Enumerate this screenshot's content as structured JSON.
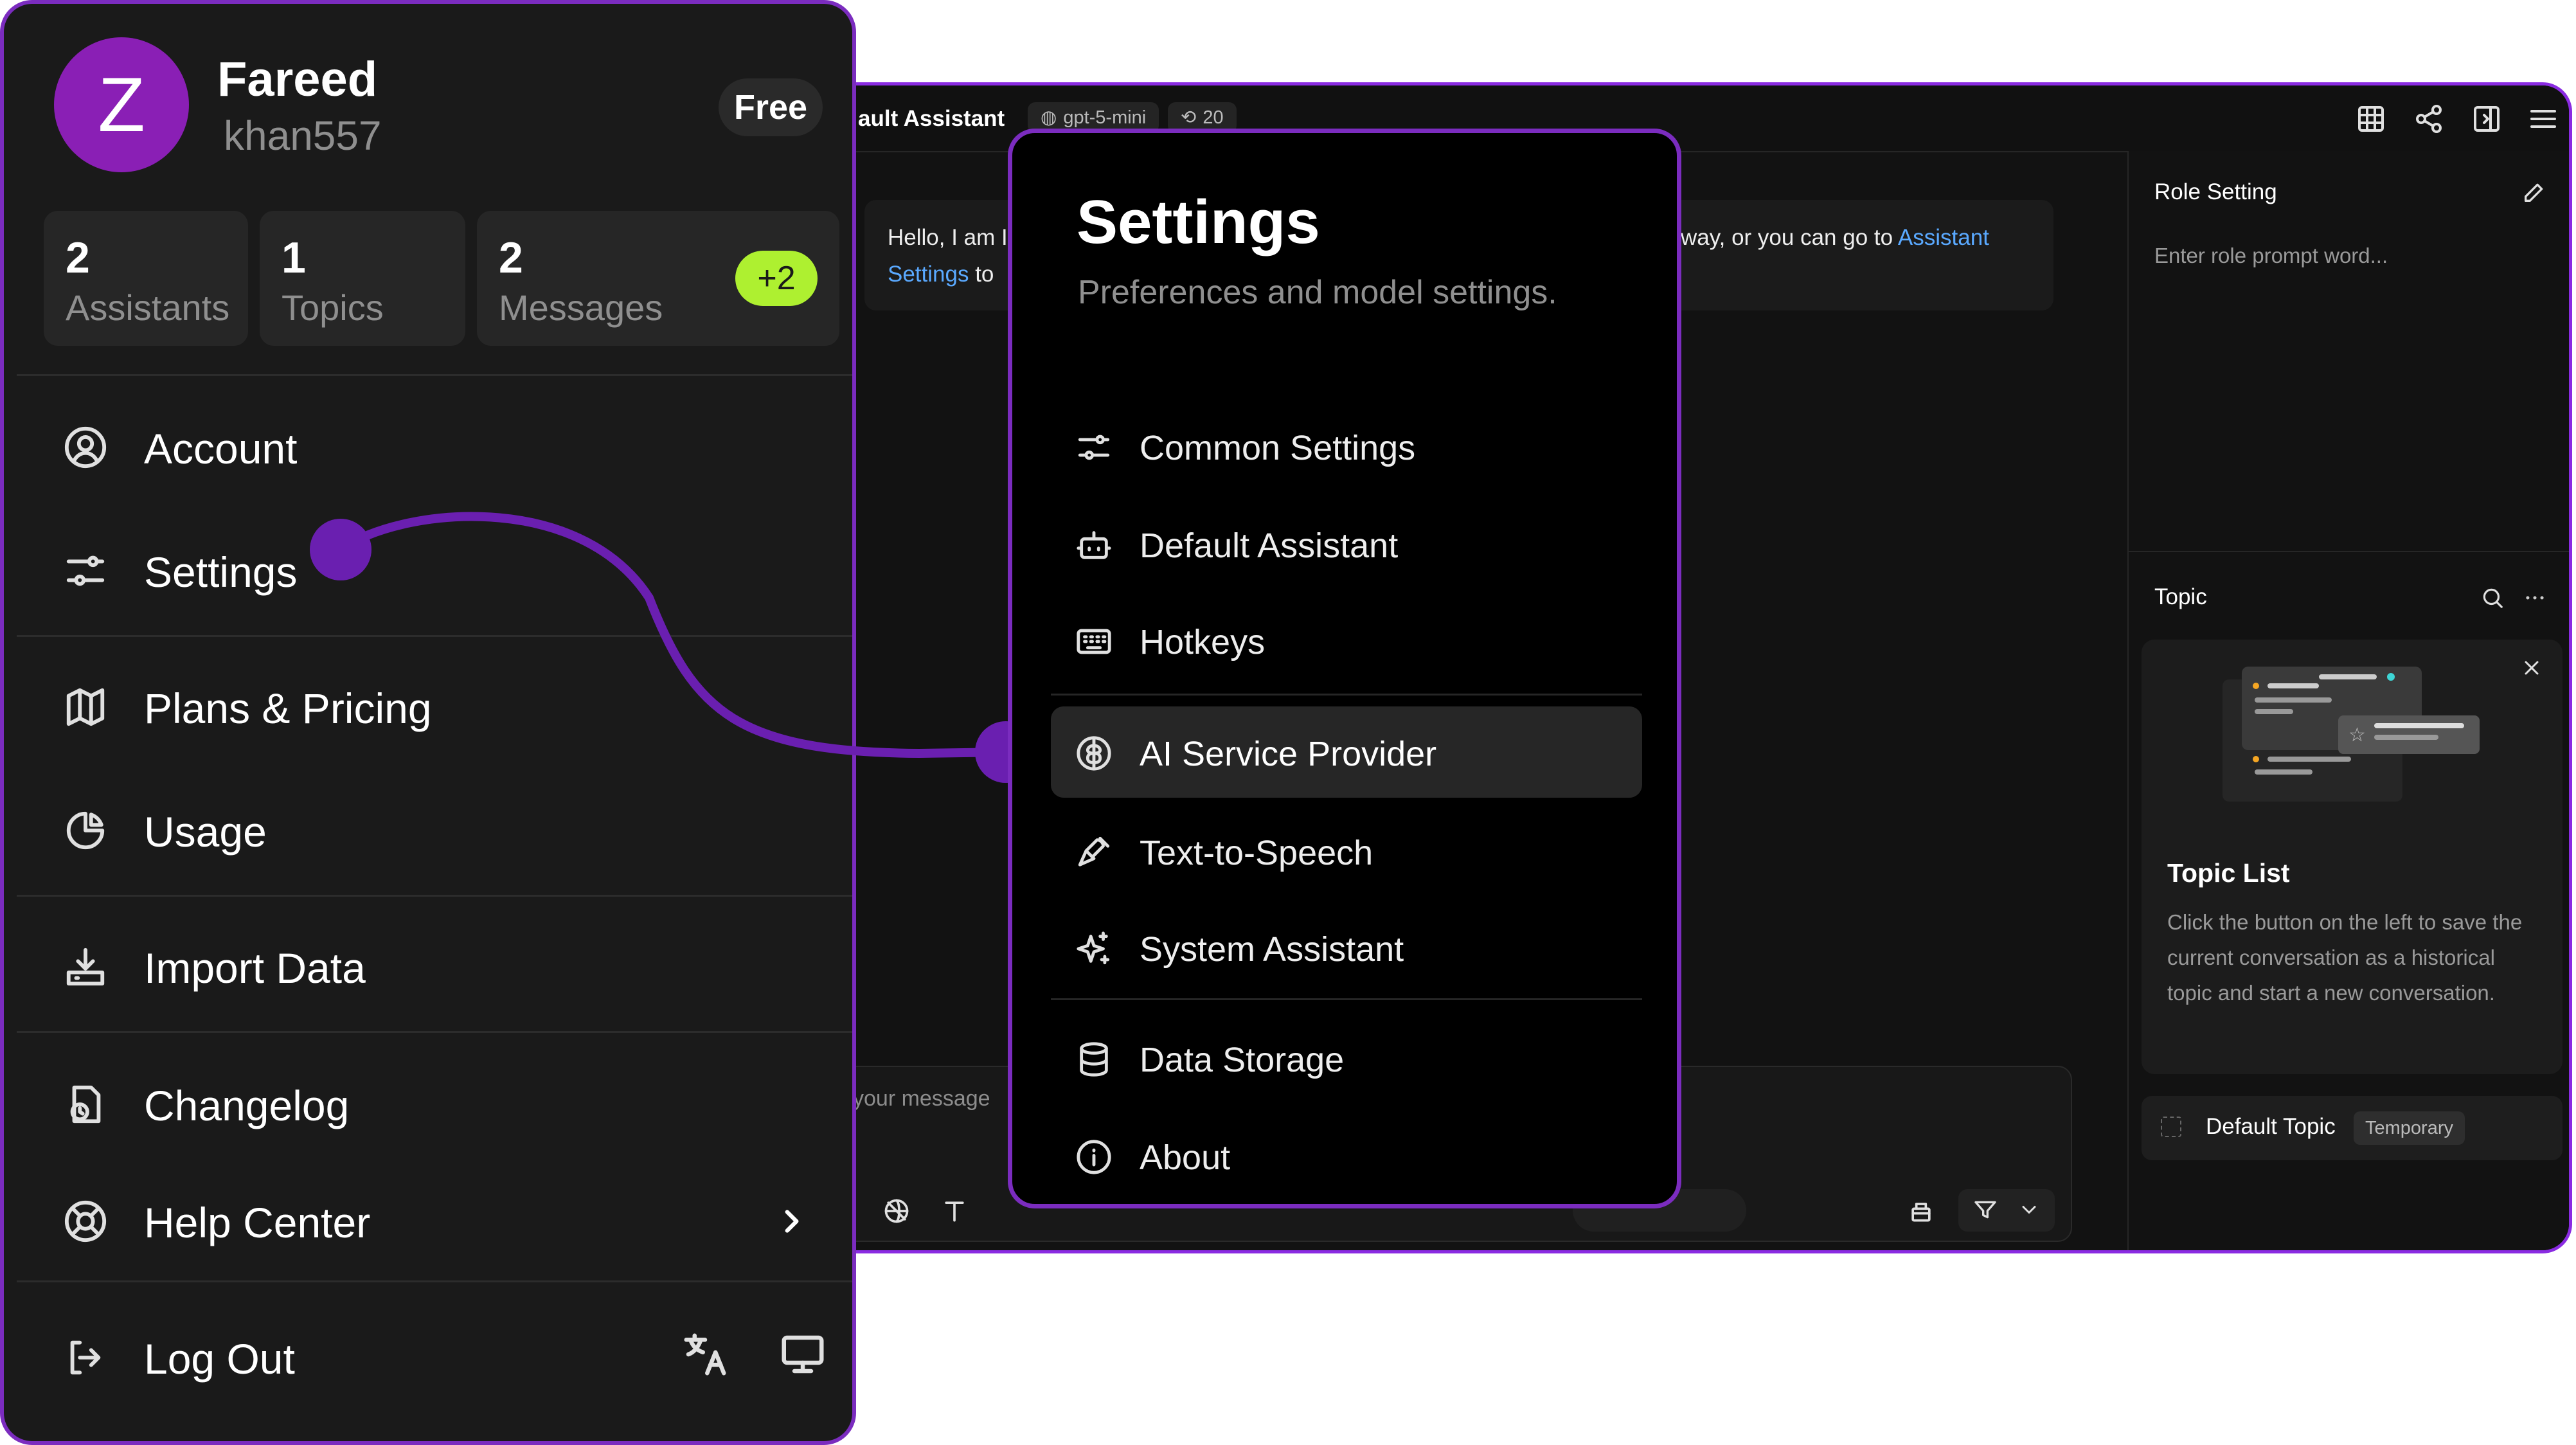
{
  "user_menu": {
    "avatar_letter": "Z",
    "name": "Fareed",
    "handle": "khan557",
    "plan": "Free",
    "stats": [
      {
        "value": "2",
        "label": "Assistants"
      },
      {
        "value": "1",
        "label": "Topics"
      },
      {
        "value": "2",
        "label": "Messages"
      }
    ],
    "stats_extra": "+2",
    "items": [
      {
        "label": "Account",
        "icon": "user-circle-icon"
      },
      {
        "label": "Settings",
        "icon": "sliders-icon"
      },
      {
        "label": "Plans & Pricing",
        "icon": "map-icon"
      },
      {
        "label": "Usage",
        "icon": "pie-chart-icon"
      },
      {
        "label": "Import Data",
        "icon": "import-icon"
      },
      {
        "label": "Changelog",
        "icon": "changelog-icon"
      },
      {
        "label": "Help Center",
        "icon": "life-buoy-icon"
      },
      {
        "label": "Log Out",
        "icon": "log-out-icon"
      }
    ]
  },
  "settings": {
    "title": "Settings",
    "subtitle": "Preferences and model settings.",
    "items": [
      {
        "label": "Common Settings",
        "icon": "sliders-icon"
      },
      {
        "label": "Default Assistant",
        "icon": "bot-icon"
      },
      {
        "label": "Hotkeys",
        "icon": "keyboard-icon"
      },
      {
        "label": "AI Service Provider",
        "icon": "brain-icon"
      },
      {
        "label": "Text-to-Speech",
        "icon": "mic-icon"
      },
      {
        "label": "System Assistant",
        "icon": "sparkles-icon"
      },
      {
        "label": "Data Storage",
        "icon": "database-icon"
      },
      {
        "label": "About",
        "icon": "info-icon"
      }
    ],
    "active_item": "AI Service Provider"
  },
  "chat": {
    "title": "ault Assistant",
    "model": "gpt-5-mini",
    "history_count": "20",
    "welcome_left_1": "Hello, I am I",
    "welcome_left_link": "Settings",
    "welcome_left_2": " to",
    "welcome_right": "way, or you can go to ",
    "welcome_right_link": "Assistant",
    "input_placeholder": "your message"
  },
  "right_panel": {
    "role_title": "Role Setting",
    "role_placeholder": "Enter role prompt word...",
    "topic_title": "Topic",
    "topic_list_title": "Topic List",
    "topic_list_desc": "Click the button on the left to save the current conversation as a historical topic and start a new conversation.",
    "default_topic": "Default Topic",
    "default_topic_badge": "Temporary"
  },
  "colors": {
    "accent": "#7b2cbf",
    "avatar": "#8a1fb5",
    "badge_green": "#aef030",
    "link": "#5aa9ff"
  }
}
